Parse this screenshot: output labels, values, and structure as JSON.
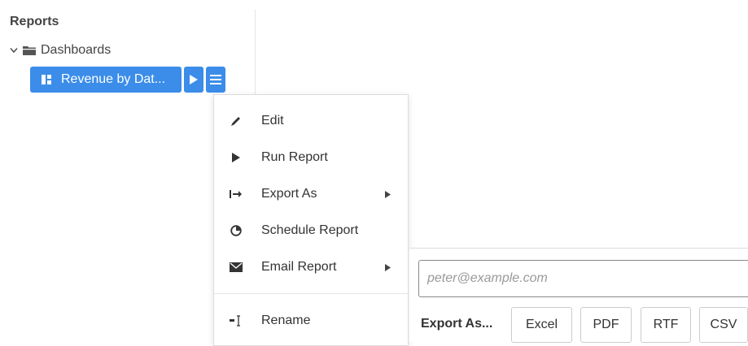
{
  "tree": {
    "title": "Reports",
    "folder": {
      "label": "Dashboards",
      "icon": "folder-icon",
      "expanded": true
    },
    "selected_report": {
      "label": "Revenue by Dat...",
      "icon": "dashboard-grid-icon"
    }
  },
  "colors": {
    "accent": "#3b8de9"
  },
  "context_menu": {
    "items": [
      {
        "label": "Edit",
        "icon": "pencil-icon",
        "has_submenu": false
      },
      {
        "label": "Run Report",
        "icon": "play-icon",
        "has_submenu": false
      },
      {
        "label": "Export As",
        "icon": "export-arrow-icon",
        "has_submenu": true
      },
      {
        "label": "Schedule Report",
        "icon": "clock-icon",
        "has_submenu": false
      },
      {
        "label": "Email Report",
        "icon": "envelope-icon",
        "has_submenu": true
      },
      {
        "label": "Rename",
        "icon": "text-cursor-icon",
        "has_submenu": false
      }
    ]
  },
  "email_panel": {
    "placeholder": "peter@example.com",
    "export_label": "Export As...",
    "formats": [
      "Excel",
      "PDF",
      "RTF",
      "CSV"
    ]
  }
}
